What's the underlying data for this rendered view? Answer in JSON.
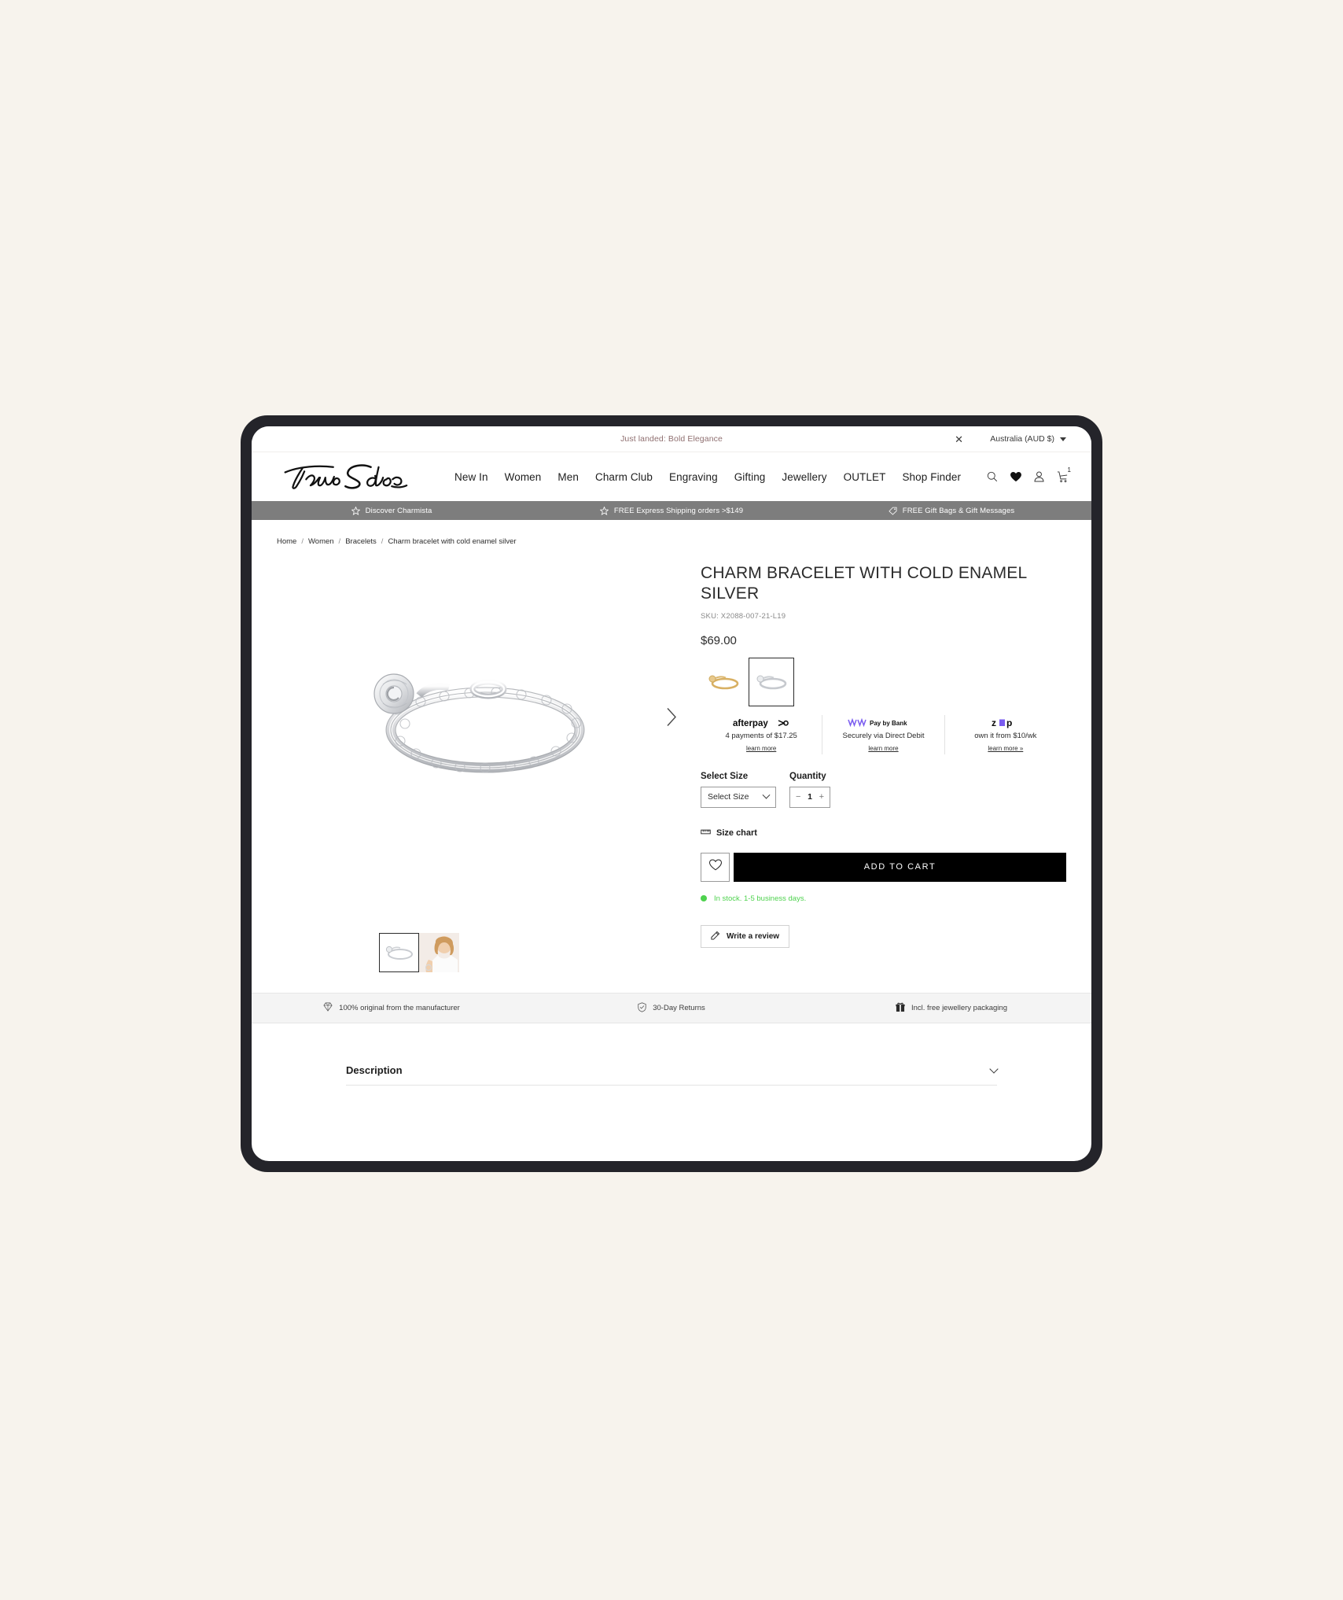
{
  "announcement": {
    "text": "Just landed: Bold Elegance",
    "close_label": "✕",
    "locale": "Australia (AUD $)"
  },
  "header": {
    "brand": "Thomas Sabo",
    "nav": [
      {
        "label": "New In"
      },
      {
        "label": "Women"
      },
      {
        "label": "Men"
      },
      {
        "label": "Charm Club"
      },
      {
        "label": "Engraving"
      },
      {
        "label": "Gifting"
      },
      {
        "label": "Jewellery"
      },
      {
        "label": "OUTLET"
      },
      {
        "label": "Shop Finder"
      }
    ],
    "cart_count": "1"
  },
  "benefits": [
    {
      "label": "Discover Charmista",
      "icon": "star-icon"
    },
    {
      "label": "FREE Express Shipping orders >$149",
      "icon": "star-icon"
    },
    {
      "label": "FREE Gift Bags & Gift Messages",
      "icon": "gift-tag-icon"
    }
  ],
  "breadcrumb": {
    "items": [
      "Home",
      "Women",
      "Bracelets",
      "Charm bracelet with cold enamel silver"
    ],
    "separator": "/"
  },
  "product": {
    "title": "CHARM BRACELET WITH COLD ENAMEL SILVER",
    "sku": "SKU: X2088-007-21-L19",
    "price": "$69.00",
    "colors": [
      {
        "name": "gold",
        "selected": false
      },
      {
        "name": "silver",
        "selected": true
      }
    ],
    "payment_options": [
      {
        "logo": "afterpay",
        "logo_text": "afterpay",
        "text": "4 payments of $17.25",
        "link": "learn more"
      },
      {
        "logo": "pay-by-bank",
        "logo_text": "Pay by Bank",
        "text": "Securely via Direct Debit",
        "link": "learn more"
      },
      {
        "logo": "zip",
        "logo_text": "zip",
        "text": "own it from $10/wk",
        "link": "learn more »"
      }
    ],
    "size": {
      "label": "Select Size",
      "selected": "Select Size"
    },
    "quantity": {
      "label": "Quantity",
      "value": "1",
      "decrement": "−",
      "increment": "+"
    },
    "size_chart_label": "Size chart",
    "add_to_cart_label": "ADD TO CART",
    "stock_status": "In stock. 1-5 business days.",
    "stock_color": "#4ed24e",
    "write_review_label": "Write a review",
    "gallery": {
      "thumbnails": [
        {
          "name": "product-shot",
          "selected": true
        },
        {
          "name": "model-shot",
          "selected": false
        }
      ],
      "next_label": "›"
    }
  },
  "trust_items": [
    {
      "label": "100% original from the manufacturer",
      "icon": "diamond-icon"
    },
    {
      "label": "30-Day Returns",
      "icon": "shield-check-icon"
    },
    {
      "label": "Incl. free jewellery packaging",
      "icon": "gift-box-icon"
    }
  ],
  "description": {
    "label": "Description"
  },
  "colors": {
    "page_background": "#f7f3ed",
    "device_frame": "#24242a",
    "benefits_bar": "#7d7d7d",
    "cta_background": "#000000",
    "announcement_text": "#8f6f70",
    "trust_bar": "#f4f4f4"
  }
}
